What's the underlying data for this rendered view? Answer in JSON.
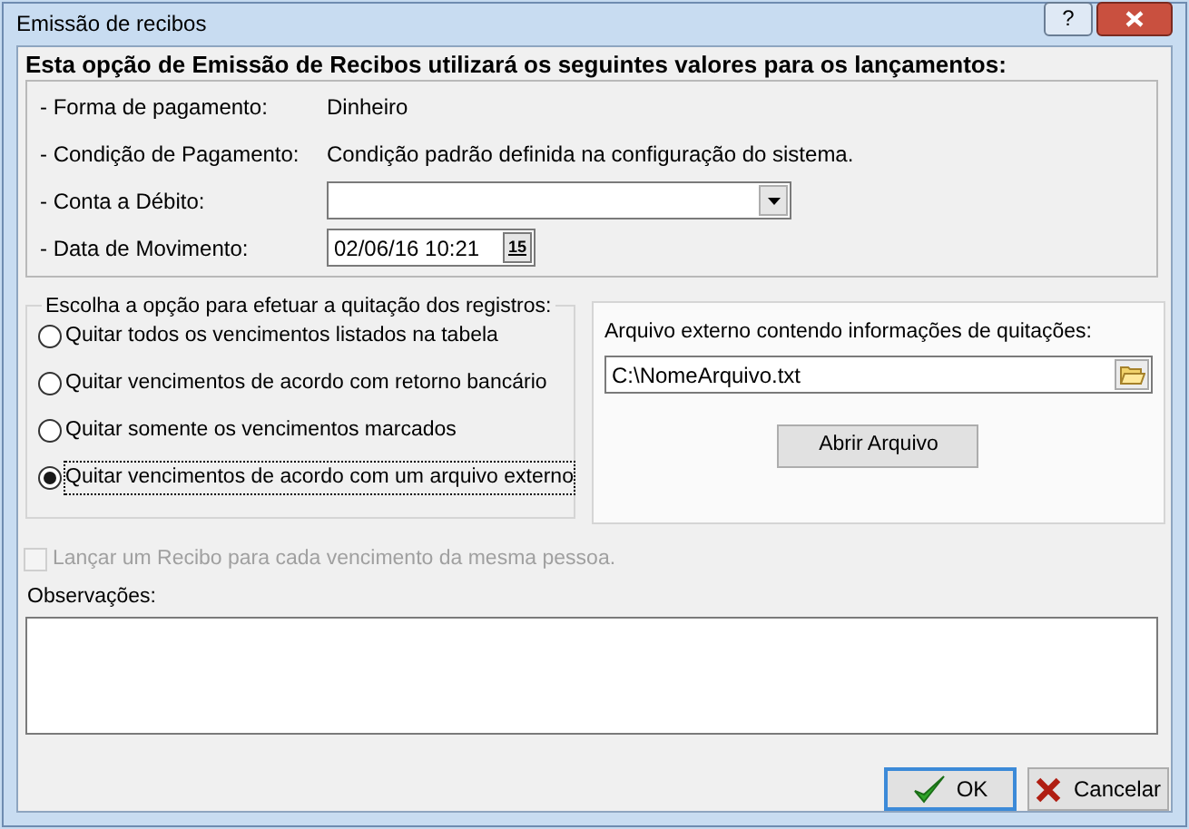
{
  "window": {
    "title": "Emissão de recibos",
    "help_button": "?"
  },
  "heading": "Esta opção de Emissão de Recibos utilizará os seguintes valores para os lançamentos:",
  "values": [
    {
      "kind": "text",
      "label": "- Forma de pagamento:",
      "value": "Dinheiro"
    },
    {
      "kind": "text",
      "label": "- Condição de Pagamento:",
      "value": "Condição padrão definida na configuração do sistema."
    },
    {
      "kind": "dropdown",
      "label": "- Conta a Débito:"
    },
    {
      "kind": "date",
      "label": "- Data de Movimento:",
      "value": "02/06/16 10:21",
      "calendar_day": "15"
    }
  ],
  "options": {
    "legend": "Escolha a opção para efetuar a quitação dos registros:",
    "items": [
      {
        "label": "Quitar todos os vencimentos listados na tabela",
        "selected": false
      },
      {
        "label": "Quitar vencimentos de acordo com retorno bancário",
        "selected": false
      },
      {
        "label": "Quitar somente os vencimentos marcados",
        "selected": false
      },
      {
        "label": "Quitar vencimentos de acordo com um arquivo externo",
        "selected": true
      }
    ]
  },
  "external_file": {
    "label": "Arquivo externo contendo informações de quitações:",
    "value": "C:\\NomeArquivo.txt",
    "open_button": "Abrir Arquivo"
  },
  "one_receipt": {
    "label": "Lançar um Recibo para cada vencimento da mesma pessoa.",
    "checked": false,
    "disabled": true
  },
  "notes": {
    "label": "Observações:"
  },
  "buttons": [
    {
      "kind": "ok",
      "label": "OK",
      "default": true
    },
    {
      "kind": "cancel",
      "label": "Cancelar",
      "default": false
    }
  ]
}
